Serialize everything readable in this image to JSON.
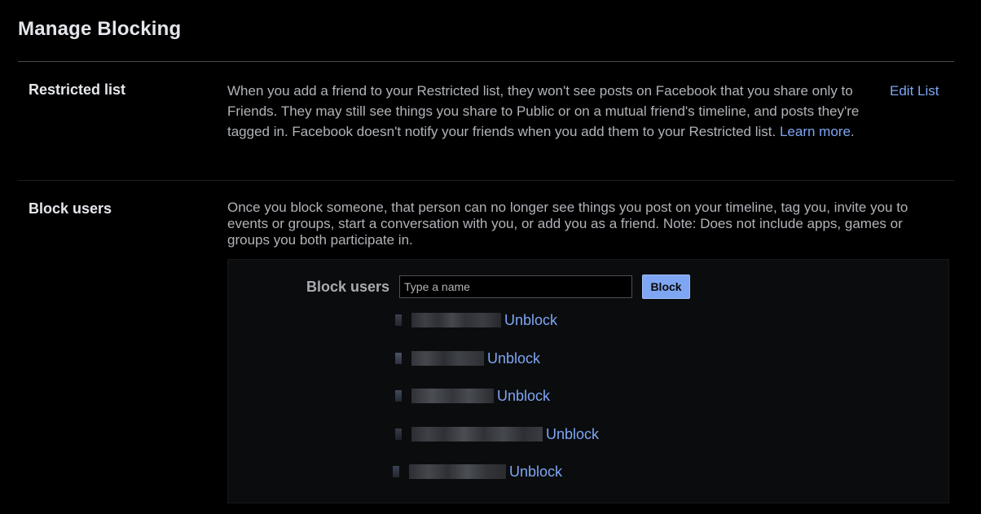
{
  "page": {
    "title": "Manage Blocking"
  },
  "restricted": {
    "label": "Restricted list",
    "description": "When you add a friend to your Restricted list, they won't see posts on Facebook that you share only to Friends. They may still see things you share to Public or on a mutual friend's timeline, and posts they're tagged in. Facebook doesn't notify your friends when you add them to your Restricted list.",
    "learn_more": "Learn more",
    "learn_more_suffix": ".",
    "edit_link": "Edit List"
  },
  "block": {
    "label": "Block users",
    "description": "Once you block someone, that person can no longer see things you post on your timeline, tag you, invite you to events or groups, start a conversation with you, or add you as a friend. Note: Does not include apps, games or groups you both participate in.",
    "panel_label": "Block users",
    "input_placeholder": "Type a name",
    "input_value": "",
    "button_label": "Block",
    "blocked_users": [
      {
        "name": "[redacted]",
        "action": "Unblock"
      },
      {
        "name": "[redacted]",
        "action": "Unblock"
      },
      {
        "name": "[redacted]",
        "action": "Unblock"
      },
      {
        "name": "[redacted]",
        "action": "Unblock"
      },
      {
        "name": "[redacted]",
        "action": "Unblock"
      }
    ]
  },
  "colors": {
    "background": "#000000",
    "text_primary": "#e4e6eb",
    "text_secondary": "#b0b3b8",
    "link": "#7ea6f2",
    "button": "#7ea6f2",
    "panel": "#0b0c0e"
  }
}
